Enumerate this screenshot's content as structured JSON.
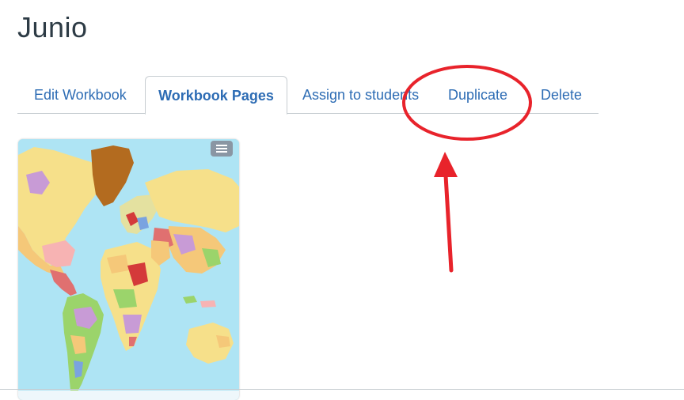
{
  "page": {
    "title": "Junio"
  },
  "tabs": [
    {
      "label": "Edit Workbook",
      "active": false
    },
    {
      "label": "Workbook Pages",
      "active": true
    },
    {
      "label": "Assign to students",
      "active": false
    },
    {
      "label": "Duplicate",
      "active": false
    },
    {
      "label": "Delete",
      "active": false
    }
  ],
  "workbook_page": {
    "thumbnail": "world-political-map",
    "menu_icon": "hamburger-menu-icon"
  },
  "annotations": {
    "circle_color": "#e8232b",
    "arrow_color": "#e8232b"
  },
  "colors": {
    "link": "#2d6cb4",
    "text": "#2d3b45",
    "border": "#c7cdd1"
  }
}
